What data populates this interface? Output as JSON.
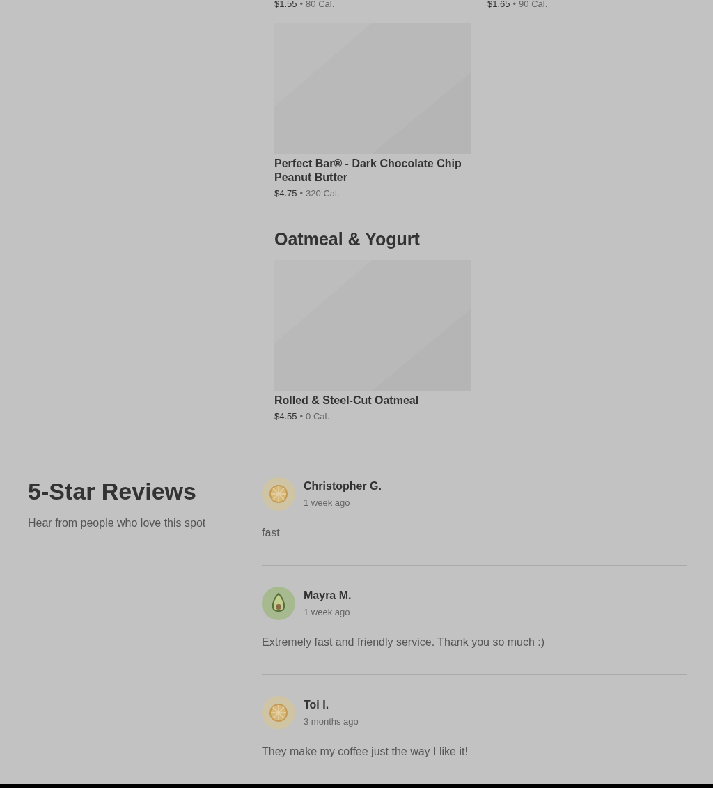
{
  "top_items": [
    {
      "price": "$1.55",
      "separator": "•",
      "calories": "80 Cal."
    },
    {
      "price": "$1.65",
      "separator": "•",
      "calories": "90 Cal."
    }
  ],
  "sections": [
    {
      "items": [
        {
          "kind": "picture",
          "name": "Perfect Bar® - Dark Chocolate Chip Peanut Butter",
          "price": "$4.75",
          "separator": "•",
          "calories": "320 Cal."
        }
      ]
    },
    {
      "title": "Oatmeal & Yogurt",
      "items": [
        {
          "kind": "picture",
          "name": "Rolled & Steel-Cut Oatmeal",
          "price": "$4.55",
          "separator": "•",
          "calories": "0 Cal."
        }
      ]
    }
  ],
  "reviews": {
    "title": "5-Star Reviews",
    "subtitle": "Hear from people who love this spot",
    "items": [
      {
        "kind": "lemon",
        "name": "Christopher G.",
        "time": "1 week ago",
        "text": "fast"
      },
      {
        "kind": "avocado",
        "name": "Mayra M.",
        "time": "1 week ago",
        "text": "Extremely fast and friendly service. Thank you so much :)"
      },
      {
        "kind": "lemon",
        "name": "Toi I.",
        "time": "3 months ago",
        "text": "They make my coffee just the way I like it!"
      }
    ]
  }
}
